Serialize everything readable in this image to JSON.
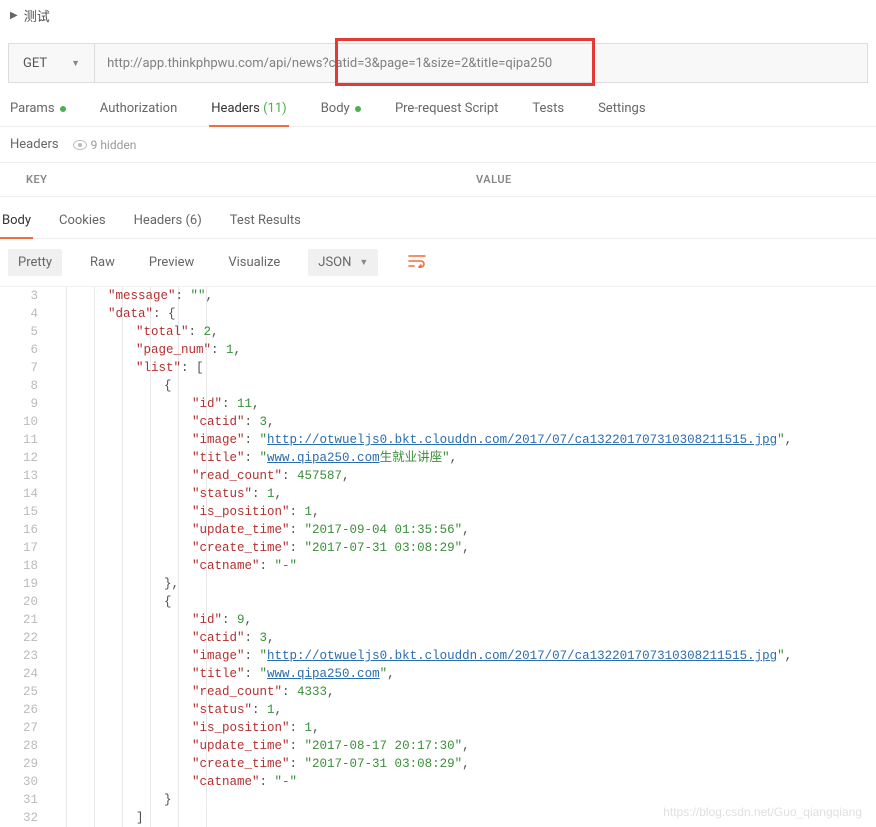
{
  "section_title": "测试",
  "request": {
    "method": "GET",
    "url_full": "http://app.thinkphpwu.com/api/news?catid=3&page=1&size=2&title=qipa250"
  },
  "tabs": {
    "params": "Params",
    "auth": "Authorization",
    "headers": "Headers",
    "headers_count": "(11)",
    "body": "Body",
    "prerequest": "Pre-request Script",
    "tests": "Tests",
    "settings": "Settings"
  },
  "headers_sub": {
    "label": "Headers",
    "hidden": "9 hidden"
  },
  "kv": {
    "key": "KEY",
    "value": "VALUE"
  },
  "response_tabs": {
    "body": "Body",
    "cookies": "Cookies",
    "headers": "Headers",
    "headers_count": "(6)",
    "test_results": "Test Results"
  },
  "toolbar": {
    "pretty": "Pretty",
    "raw": "Raw",
    "preview": "Preview",
    "visualize": "Visualize",
    "format": "JSON"
  },
  "json_lines": [
    {
      "num": 3,
      "indent": 2,
      "html": "<span class='k'>\"message\"</span><span class='p'>: </span><span class='s'>\"\"</span><span class='p'>,</span>"
    },
    {
      "num": 4,
      "indent": 2,
      "html": "<span class='k'>\"data\"</span><span class='p'>: {</span>"
    },
    {
      "num": 5,
      "indent": 3,
      "html": "<span class='k'>\"total\"</span><span class='p'>: </span><span class='n'>2</span><span class='p'>,</span>"
    },
    {
      "num": 6,
      "indent": 3,
      "html": "<span class='k'>\"page_num\"</span><span class='p'>: </span><span class='n'>1</span><span class='p'>,</span>"
    },
    {
      "num": 7,
      "indent": 3,
      "html": "<span class='k'>\"list\"</span><span class='p'>: [</span>"
    },
    {
      "num": 8,
      "indent": 4,
      "html": "<span class='p'>{</span>"
    },
    {
      "num": 9,
      "indent": 5,
      "html": "<span class='k'>\"id\"</span><span class='p'>: </span><span class='n'>11</span><span class='p'>,</span>"
    },
    {
      "num": 10,
      "indent": 5,
      "html": "<span class='k'>\"catid\"</span><span class='p'>: </span><span class='n'>3</span><span class='p'>,</span>"
    },
    {
      "num": 11,
      "indent": 5,
      "html": "<span class='k'>\"image\"</span><span class='p'>: </span><span class='s'>\"<span class='link'>http://otwueljs0.bkt.clouddn.com/2017/07/ca132201707310308211515.jpg</span>\"</span><span class='p'>,</span>"
    },
    {
      "num": 12,
      "indent": 5,
      "html": "<span class='k'>\"title\"</span><span class='p'>: </span><span class='s'>\"<span class='link'>www.qipa250.com</span>生就业讲座\"</span><span class='p'>,</span>"
    },
    {
      "num": 13,
      "indent": 5,
      "html": "<span class='k'>\"read_count\"</span><span class='p'>: </span><span class='n'>457587</span><span class='p'>,</span>"
    },
    {
      "num": 14,
      "indent": 5,
      "html": "<span class='k'>\"status\"</span><span class='p'>: </span><span class='n'>1</span><span class='p'>,</span>"
    },
    {
      "num": 15,
      "indent": 5,
      "html": "<span class='k'>\"is_position\"</span><span class='p'>: </span><span class='n'>1</span><span class='p'>,</span>"
    },
    {
      "num": 16,
      "indent": 5,
      "html": "<span class='k'>\"update_time\"</span><span class='p'>: </span><span class='s'>\"2017-09-04 01:35:56\"</span><span class='p'>,</span>"
    },
    {
      "num": 17,
      "indent": 5,
      "html": "<span class='k'>\"create_time\"</span><span class='p'>: </span><span class='s'>\"2017-07-31 03:08:29\"</span><span class='p'>,</span>"
    },
    {
      "num": 18,
      "indent": 5,
      "html": "<span class='k'>\"catname\"</span><span class='p'>: </span><span class='s'>\"-\"</span>"
    },
    {
      "num": 19,
      "indent": 4,
      "html": "<span class='p'>},</span>"
    },
    {
      "num": 20,
      "indent": 4,
      "html": "<span class='p'>{</span>"
    },
    {
      "num": 21,
      "indent": 5,
      "html": "<span class='k'>\"id\"</span><span class='p'>: </span><span class='n'>9</span><span class='p'>,</span>"
    },
    {
      "num": 22,
      "indent": 5,
      "html": "<span class='k'>\"catid\"</span><span class='p'>: </span><span class='n'>3</span><span class='p'>,</span>"
    },
    {
      "num": 23,
      "indent": 5,
      "html": "<span class='k'>\"image\"</span><span class='p'>: </span><span class='s'>\"<span class='link'>http://otwueljs0.bkt.clouddn.com/2017/07/ca132201707310308211515.jpg</span>\"</span><span class='p'>,</span>"
    },
    {
      "num": 24,
      "indent": 5,
      "html": "<span class='k'>\"title\"</span><span class='p'>: </span><span class='s'>\"<span class='link'>www.qipa250.com</span>\"</span><span class='p'>,</span>"
    },
    {
      "num": 25,
      "indent": 5,
      "html": "<span class='k'>\"read_count\"</span><span class='p'>: </span><span class='n'>4333</span><span class='p'>,</span>"
    },
    {
      "num": 26,
      "indent": 5,
      "html": "<span class='k'>\"status\"</span><span class='p'>: </span><span class='n'>1</span><span class='p'>,</span>"
    },
    {
      "num": 27,
      "indent": 5,
      "html": "<span class='k'>\"is_position\"</span><span class='p'>: </span><span class='n'>1</span><span class='p'>,</span>"
    },
    {
      "num": 28,
      "indent": 5,
      "html": "<span class='k'>\"update_time\"</span><span class='p'>: </span><span class='s'>\"2017-08-17 20:17:30\"</span><span class='p'>,</span>"
    },
    {
      "num": 29,
      "indent": 5,
      "html": "<span class='k'>\"create_time\"</span><span class='p'>: </span><span class='s'>\"2017-07-31 03:08:29\"</span><span class='p'>,</span>"
    },
    {
      "num": 30,
      "indent": 5,
      "html": "<span class='k'>\"catname\"</span><span class='p'>: </span><span class='s'>\"-\"</span>"
    },
    {
      "num": 31,
      "indent": 4,
      "html": "<span class='p'>}</span>"
    },
    {
      "num": 32,
      "indent": 3,
      "html": "<span class='p'>]</span>"
    }
  ],
  "watermark": "https://blog.csdn.net/Guo_qiangqiang"
}
